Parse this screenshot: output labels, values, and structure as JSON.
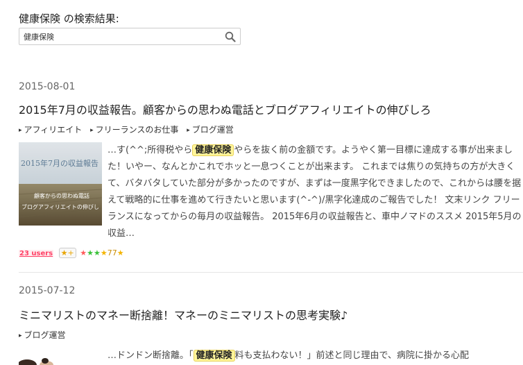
{
  "search": {
    "heading": "健康保険 の検索結果:",
    "value": "健康保険",
    "button_icon": "search-icon"
  },
  "posts": [
    {
      "date": "2015-08-01",
      "title": "2015年7月の収益報告。顧客からの思わぬ電話とブログアフィリエイトの伸びしろ",
      "categories": [
        "アフィリエイト",
        "フリーランスのお仕事",
        "ブログ運営"
      ],
      "thumbnail": {
        "title_text": "2015年7月の収益報告",
        "sub_text_1": "顧客からの思わぬ電話",
        "sub_text_2": "ブログアフィリエイトの伸びし"
      },
      "excerpt": {
        "before": "…す(^^;所得税やら",
        "highlight": "健康保険",
        "after": "やらを抜く前の金額です。ようやく第一目標に達成する事が出来ました！いやー、なんとかこれでホッと一息つくことが出来ます。 これまでは焦りの気持ちの方が大きくて、バタバタしていた部分が多かったのですが、まずは一度黒字化できましたので、これからは腰を据えて戦略的に仕事を進めて行きたいと思います(^-^)/黒字化達成のご報告でした！ 文末リンク フリーランスになってからの毎月の収益報告。 2015年6月の収益報告と、車中ノマドのススメ 2015年5月の収益…"
      },
      "hatena": {
        "users": "23 users",
        "star_add": "★+",
        "star_count": "77"
      }
    },
    {
      "date": "2015-07-12",
      "title": "ミニマリストのマネー断捨離！マネーのミニマリストの思考実験♪",
      "categories": [
        "ブログ運営"
      ],
      "excerpt": {
        "before": "…ドンドン断捨離。「",
        "highlight": "健康保険",
        "after": "料も支払わない！」前述と同じ理由で、病院に掛かる心配"
      }
    }
  ],
  "colors": {
    "highlight_bg": "#fff59a",
    "users_red": "#ff4166",
    "star_yellow": "#f4b400"
  }
}
